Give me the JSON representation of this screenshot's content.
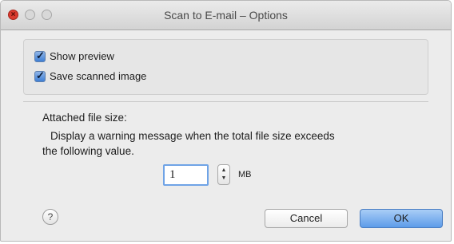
{
  "window": {
    "title": "Scan to E-mail – Options"
  },
  "options": {
    "show_preview": {
      "label": "Show preview",
      "checked": true
    },
    "save_scanned_image": {
      "label": "Save scanned image",
      "checked": true
    }
  },
  "file_size": {
    "heading": "Attached file size:",
    "description_line1": "Display a warning message when the total file size exceeds",
    "description_line2": "the following value.",
    "value": "1",
    "unit": "MB"
  },
  "buttons": {
    "help": "?",
    "cancel": "Cancel",
    "ok": "OK"
  },
  "colors": {
    "accent": "#5d9ce9",
    "close_button": "#d93a2e",
    "background": "#ececec"
  }
}
